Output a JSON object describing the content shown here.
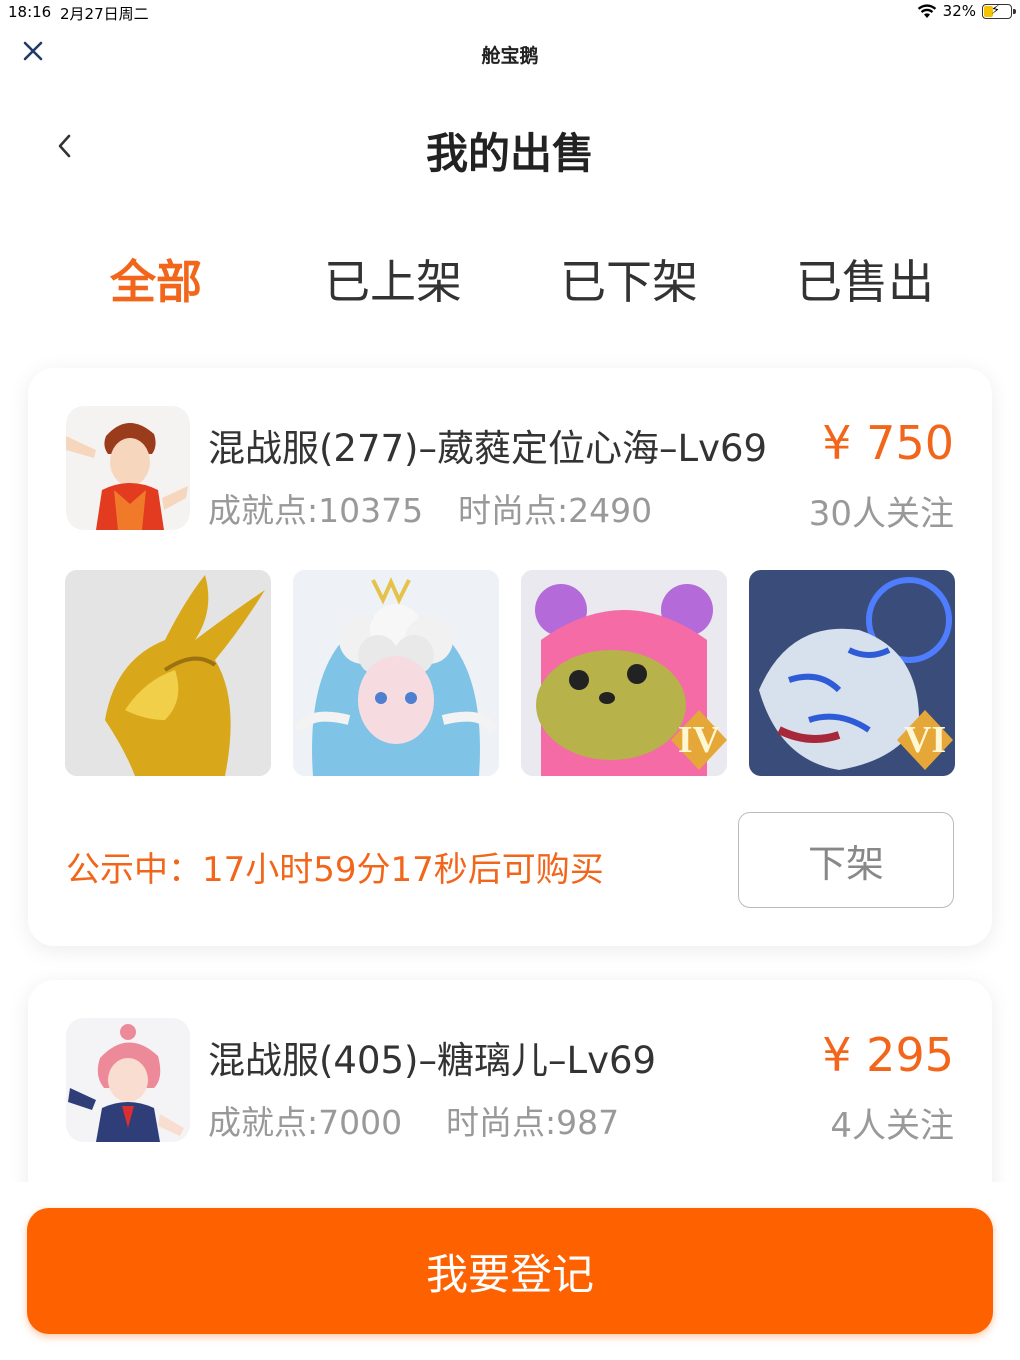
{
  "status_bar": {
    "time": "18:16",
    "date": "2月27日周二",
    "battery": "32%",
    "icons": [
      "wifi-icon",
      "battery-charging-icon"
    ]
  },
  "webview": {
    "app_name": "舱宝鹅",
    "close_icon": "close-icon"
  },
  "header": {
    "back_icon": "chevron-left-icon",
    "title": "我的出售"
  },
  "tabs": [
    {
      "label": "全部",
      "active": true
    },
    {
      "label": "已上架",
      "active": false
    },
    {
      "label": "已下架",
      "active": false
    },
    {
      "label": "已售出",
      "active": false
    }
  ],
  "listings": [
    {
      "title": "混战服(277)–葳蕤定位心海–Lv69",
      "achievement": "成就点:10375",
      "fashion": "时尚点:2490",
      "price": "¥ 750",
      "watchers": "30人关注",
      "thumbnails": [
        {
          "name": "golden-dragon-thumbnail",
          "badge": ""
        },
        {
          "name": "cloud-maiden-thumbnail",
          "badge": ""
        },
        {
          "name": "pink-bear-pet-thumbnail",
          "badge": "IV"
        },
        {
          "name": "white-tiger-pet-thumbnail",
          "badge": "VI"
        }
      ],
      "notice": "公示中：17小时59分17秒后可购买",
      "action_label": "下架"
    },
    {
      "title": "混战服(405)–糖璃儿–Lv69",
      "achievement": "成就点:7000",
      "fashion": "时尚点:987",
      "price": "¥ 295",
      "watchers": "4人关注"
    }
  ],
  "register_button": "我要登记",
  "colors": {
    "accent": "#f2661b",
    "button": "#fe6100",
    "muted_text": "#999999"
  }
}
